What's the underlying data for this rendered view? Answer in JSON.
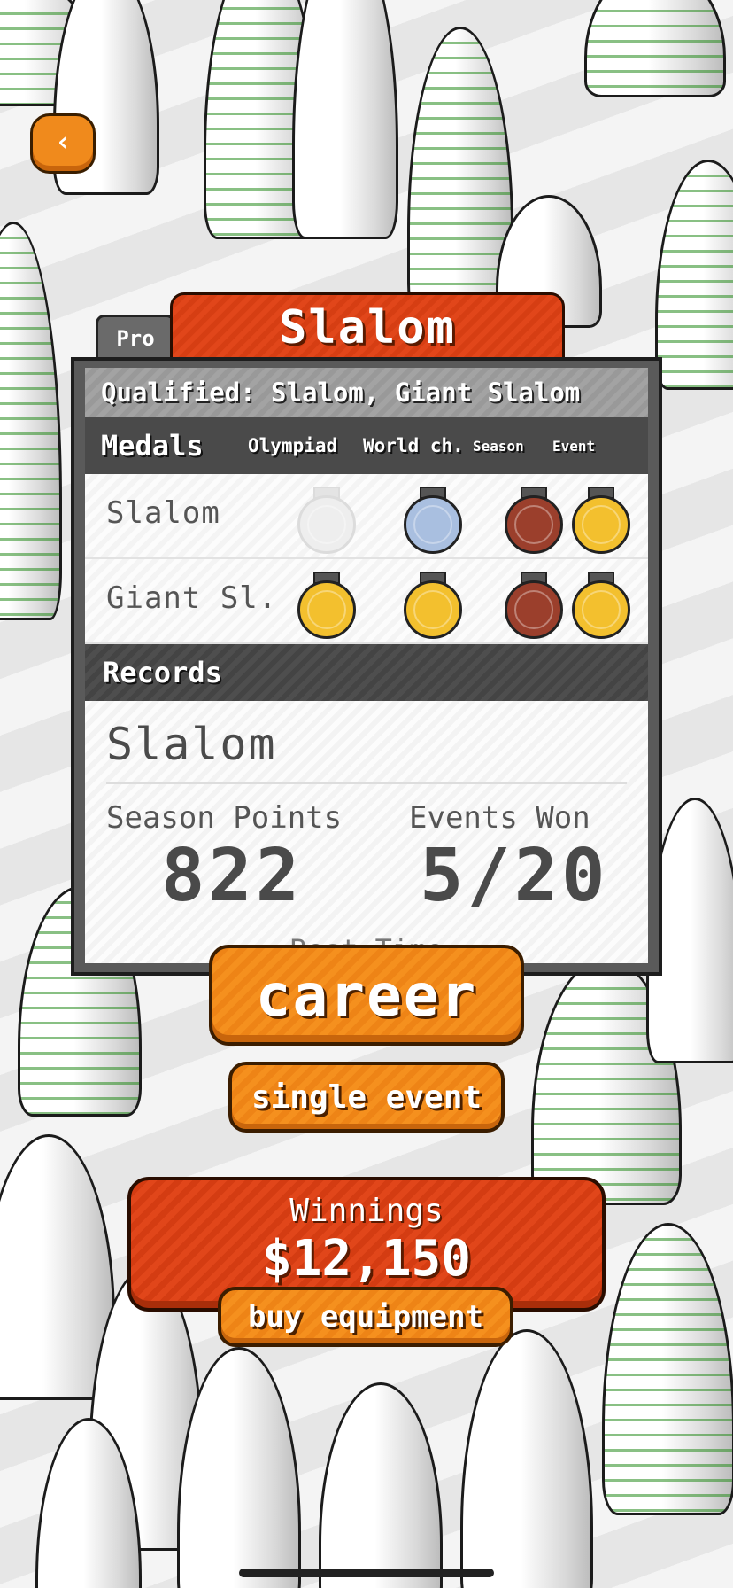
{
  "nav": {
    "back_icon": "‹"
  },
  "title": {
    "level_tab": "Pro",
    "event": "Slalom"
  },
  "panel": {
    "qualified": "Qualified: Slalom, Giant Slalom",
    "medals_header": "Medals",
    "medal_columns": [
      "Olympiad",
      "World ch.",
      "Season",
      "Event"
    ],
    "medal_rows": [
      {
        "label": "Slalom",
        "medals": [
          "none",
          "silver",
          "bronze",
          "gold"
        ]
      },
      {
        "label": "Giant Sl.",
        "medals": [
          "gold",
          "gold",
          "bronze",
          "gold"
        ]
      }
    ],
    "records_header": "Records",
    "record_event": "Slalom",
    "season_points_label": "Season Points",
    "season_points": "822",
    "events_won_label": "Events Won",
    "events_won": "5/20",
    "best_time_label": "Best Time"
  },
  "buttons": {
    "career": "career",
    "single_event": "single event",
    "buy_equipment": "buy equipment"
  },
  "winnings": {
    "label": "Winnings",
    "amount": "$12,150"
  },
  "colors": {
    "orange": "#f08a1c",
    "red": "#e1461a",
    "gold": "#f3c02e",
    "silver": "#a9bfe0",
    "bronze": "#9b3f2c",
    "none": "#eeeeee"
  }
}
